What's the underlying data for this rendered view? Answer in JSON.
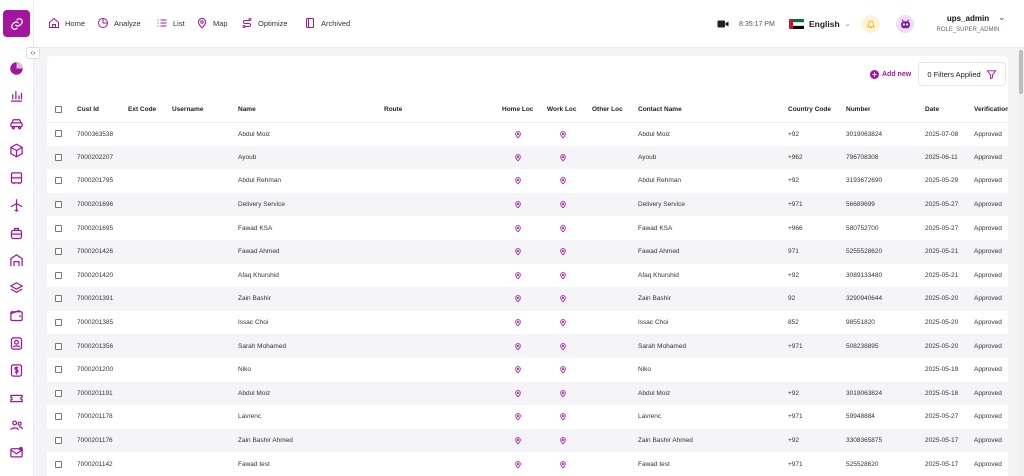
{
  "nav": [
    {
      "label": "Home",
      "icon": "home-icon"
    },
    {
      "label": "Analyze",
      "icon": "pie-chart-icon"
    },
    {
      "label": "List",
      "icon": "list-icon"
    },
    {
      "label": "Map",
      "icon": "map-pin-icon"
    },
    {
      "label": "Optimize",
      "icon": "route-icon"
    },
    {
      "label": "Archived",
      "icon": "archive-icon"
    }
  ],
  "topbar": {
    "time": "8:35:17 PM",
    "language": "English",
    "user_name": "ups_admin",
    "user_role": "ROLE_SUPER_ADMIN"
  },
  "toolbar": {
    "add_new_label": "Add new",
    "filters_label": "0 Filters Applied"
  },
  "colors": {
    "accent": "#a3159e",
    "bell_bg": "#fff3d9",
    "bell": "#f2b100"
  },
  "table": {
    "columns": [
      "Cust Id",
      "Ext Code",
      "Username",
      "Name",
      "Route",
      "Home Loc",
      "Work Loc",
      "Other Loc",
      "Contact Name",
      "Country Code",
      "Number",
      "Date",
      "Verification"
    ],
    "rows": [
      {
        "cust_id": "7000363538",
        "ext_code": "",
        "username": "",
        "name": "Abdul Moiz",
        "route": "",
        "contact": "Abdul Moiz",
        "country_code": "+92",
        "number": "3019063824",
        "date": "2025-07-08",
        "verification": "Approved"
      },
      {
        "cust_id": "7000202207",
        "ext_code": "",
        "username": "",
        "name": "Ayoub",
        "route": "",
        "contact": "Ayoub",
        "country_code": "+962",
        "number": "796708308",
        "date": "2025-06-11",
        "verification": "Approved"
      },
      {
        "cust_id": "7000201795",
        "ext_code": "",
        "username": "",
        "name": "Abdul Rehman",
        "route": "",
        "contact": "Abdul Rehman",
        "country_code": "+92",
        "number": "3193672690",
        "date": "2025-05-29",
        "verification": "Approved"
      },
      {
        "cust_id": "7000201696",
        "ext_code": "",
        "username": "",
        "name": "Delivery Service",
        "route": "",
        "contact": "Delivery Service",
        "country_code": "+971",
        "number": "56689699",
        "date": "2025-05-27",
        "verification": "Approved"
      },
      {
        "cust_id": "7000201695",
        "ext_code": "",
        "username": "",
        "name": "Fawad KSA",
        "route": "",
        "contact": "Fawad KSA",
        "country_code": "+966",
        "number": "580752700",
        "date": "2025-05-27",
        "verification": "Approved"
      },
      {
        "cust_id": "7000201426",
        "ext_code": "",
        "username": "",
        "name": "Fawad Ahmed",
        "route": "",
        "contact": "Fawad Ahmed",
        "country_code": "971",
        "number": "5255528620",
        "date": "2025-05-21",
        "verification": "Approved"
      },
      {
        "cust_id": "7000201420",
        "ext_code": "",
        "username": "",
        "name": "Afaq Khurshid",
        "route": "",
        "contact": "Afaq Khurshid",
        "country_code": "+92",
        "number": "3089133480",
        "date": "2025-05-21",
        "verification": "Approved"
      },
      {
        "cust_id": "7000201391",
        "ext_code": "",
        "username": "",
        "name": "Zain Bashir",
        "route": "",
        "contact": "Zain Bashir",
        "country_code": "92",
        "number": "3290940644",
        "date": "2025-05-20",
        "verification": "Approved"
      },
      {
        "cust_id": "7000201385",
        "ext_code": "",
        "username": "",
        "name": "Issac Choi",
        "route": "",
        "contact": "Issac Choi",
        "country_code": "852",
        "number": "98551820",
        "date": "2025-05-20",
        "verification": "Approved"
      },
      {
        "cust_id": "7000201356",
        "ext_code": "",
        "username": "",
        "name": "Sarah Mohamed",
        "route": "",
        "contact": "Sarah Mohamed",
        "country_code": "+971",
        "number": "508238895",
        "date": "2025-05-20",
        "verification": "Approved"
      },
      {
        "cust_id": "7000201200",
        "ext_code": "",
        "username": "",
        "name": "Niko",
        "route": "",
        "contact": "Niko",
        "country_code": "",
        "number": "",
        "date": "2025-05-19",
        "verification": "Approved"
      },
      {
        "cust_id": "7000201191",
        "ext_code": "",
        "username": "",
        "name": "Abdul Moiz",
        "route": "",
        "contact": "Abdul Moiz",
        "country_code": "+92",
        "number": "3019063824",
        "date": "2025-05-18",
        "verification": "Approved"
      },
      {
        "cust_id": "7000201178",
        "ext_code": "",
        "username": "",
        "name": "Lavrenc",
        "route": "",
        "contact": "Lavrenc",
        "country_code": "+971",
        "number": "59948884",
        "date": "2025-05-27",
        "verification": "Approved"
      },
      {
        "cust_id": "7000201176",
        "ext_code": "",
        "username": "",
        "name": "Zain Bashir Ahmed",
        "route": "",
        "contact": "Zain Bashir Ahmed",
        "country_code": "+92",
        "number": "3308365875",
        "date": "2025-05-17",
        "verification": "Approved"
      },
      {
        "cust_id": "7000201142",
        "ext_code": "",
        "username": "",
        "name": "Fawad test",
        "route": "",
        "contact": "Fawad test",
        "country_code": "+971",
        "number": "525528620",
        "date": "2025-05-17",
        "verification": "Approved"
      }
    ]
  }
}
